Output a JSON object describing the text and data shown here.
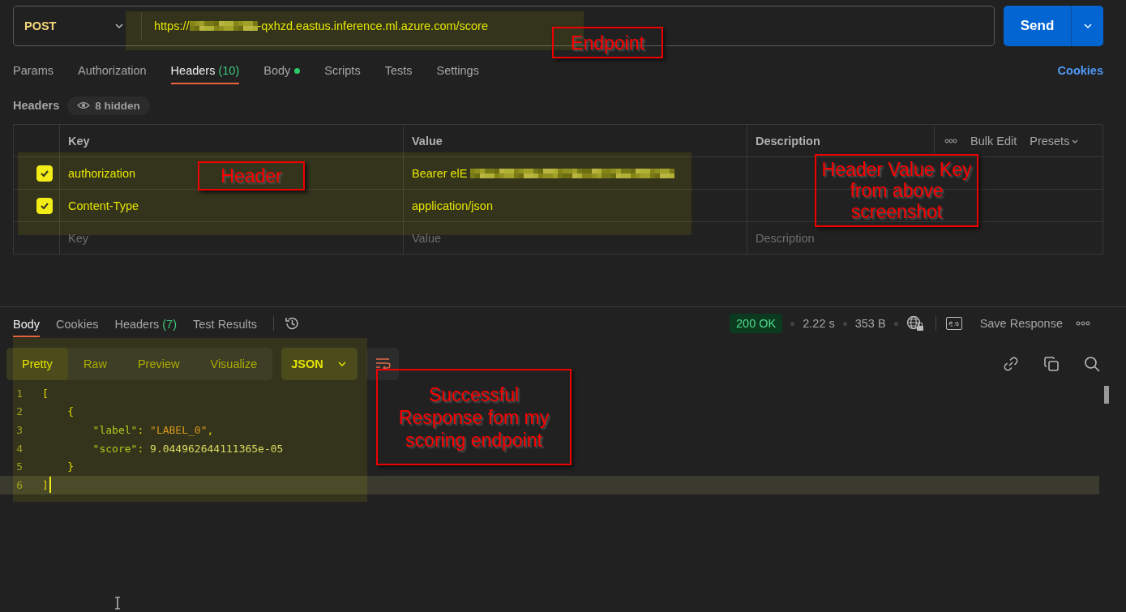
{
  "request": {
    "method": "POST",
    "url_start": "https://",
    "url_end": "-qxhzd.eastus.inference.ml.azure.com/score",
    "url_redacted": true,
    "send": "Send"
  },
  "request_tabs": [
    {
      "label": "Params",
      "selected": false
    },
    {
      "label": "Authorization",
      "selected": false
    },
    {
      "label": "Headers",
      "count": "(10)",
      "selected": true
    },
    {
      "label": "Body",
      "dot": true,
      "selected": false
    },
    {
      "label": "Scripts",
      "selected": false
    },
    {
      "label": "Tests",
      "selected": false
    },
    {
      "label": "Settings",
      "selected": false
    }
  ],
  "cookies_link": "Cookies",
  "headers_section": {
    "title": "Headers",
    "hidden": "8 hidden"
  },
  "headers_table": {
    "columns": [
      "Key",
      "Value",
      "Description"
    ],
    "actions": [
      "Bulk Edit",
      "Presets"
    ],
    "rows": [
      {
        "checked": true,
        "key": "authorization",
        "value": "Bearer elE",
        "value_redacted": true
      },
      {
        "checked": true,
        "key": "Content-Type",
        "value": "application/json",
        "value_redacted": false
      }
    ],
    "empty_row": [
      {
        "placeholder": "Key"
      },
      {
        "placeholder": "Value"
      },
      {
        "placeholder": "Description"
      }
    ]
  },
  "response": {
    "tabs": [
      {
        "label": "Body",
        "selected": true
      },
      {
        "label": "Cookies",
        "selected": false
      },
      {
        "label": "Headers",
        "count": "(7)",
        "selected": false
      },
      {
        "label": "Test Results",
        "selected": false
      }
    ],
    "status": "200 OK",
    "time": "2.22 s",
    "size": "353 B",
    "save": "Save Response",
    "views": [
      {
        "label": "Pretty",
        "selected": true
      },
      {
        "label": "Raw",
        "selected": false
      },
      {
        "label": "Preview",
        "selected": false
      },
      {
        "label": "Visualize",
        "selected": false
      }
    ],
    "format": "JSON",
    "lines": [
      {
        "number": "1",
        "current": false,
        "tokens": [
          {
            "kind": "punct",
            "text": "["
          }
        ]
      },
      {
        "number": "2",
        "current": false,
        "tokens": [
          {
            "kind": "punct",
            "text": "    {"
          }
        ]
      },
      {
        "number": "3",
        "current": false,
        "tokens": [
          {
            "kind": "key",
            "text": "        \"label\""
          },
          {
            "kind": "punct",
            "text": ": "
          },
          {
            "kind": "string",
            "text": "\"LABEL_0\""
          },
          {
            "kind": "punct",
            "text": ","
          }
        ]
      },
      {
        "number": "4",
        "current": false,
        "tokens": [
          {
            "kind": "key",
            "text": "        \"score\""
          },
          {
            "kind": "punct",
            "text": ": "
          },
          {
            "kind": "number",
            "text": "9.044962644111365e-05"
          }
        ]
      },
      {
        "number": "5",
        "current": false,
        "tokens": [
          {
            "kind": "punct",
            "text": "    }"
          }
        ]
      },
      {
        "number": "6",
        "current": true,
        "tokens": [
          {
            "kind": "punct",
            "text": "]"
          }
        ]
      }
    ]
  },
  "annotations": [
    {
      "text": "Endpoint"
    },
    {
      "text": "Header"
    },
    {
      "text": "Header Value Key from above screenshot"
    },
    {
      "text": "Successful Response fom my scoring endpoint"
    }
  ]
}
